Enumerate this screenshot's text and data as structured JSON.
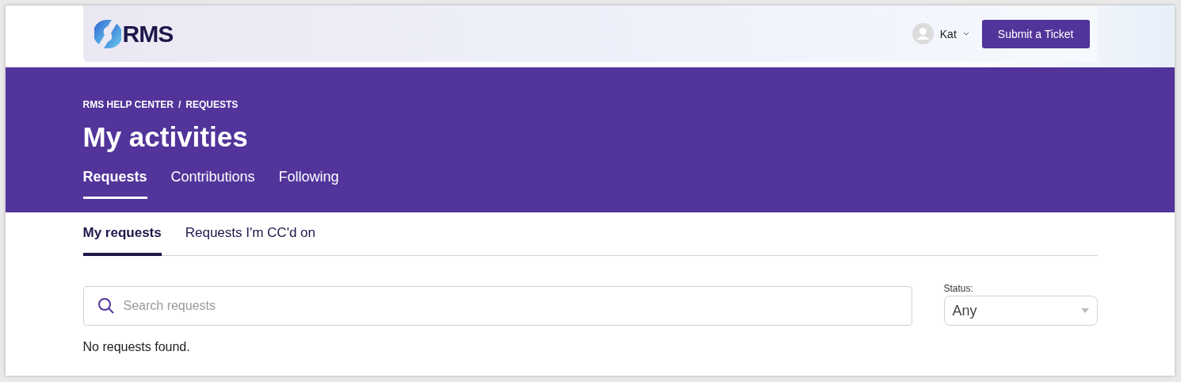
{
  "header": {
    "logo": "RMS",
    "user": {
      "name": "Kat"
    },
    "submit_button": "Submit a Ticket"
  },
  "breadcrumb": {
    "items": [
      "RMS HELP CENTER",
      "REQUESTS"
    ],
    "separator": "/"
  },
  "title": "My activities",
  "tabs": [
    {
      "label": "Requests",
      "selected": true
    },
    {
      "label": "Contributions",
      "selected": false
    },
    {
      "label": "Following",
      "selected": false
    }
  ],
  "subtabs": [
    {
      "label": "My requests",
      "selected": true
    },
    {
      "label": "Requests I'm CC'd on",
      "selected": false
    }
  ],
  "search": {
    "placeholder": "Search requests"
  },
  "status_filter": {
    "label": "Status:",
    "value": "Any"
  },
  "empty_message": "No requests found."
}
